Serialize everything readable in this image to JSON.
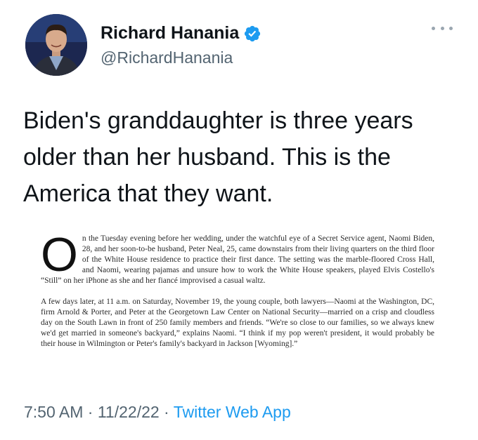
{
  "user": {
    "display_name": "Richard Hanania",
    "handle": "@RichardHanania",
    "verified_icon": "verified-badge-icon",
    "more_icon": "more-options-icon"
  },
  "tweet": {
    "text": "Biden's granddaughter is three years older than her husband. This is the America that they want."
  },
  "article": {
    "dropcap": "O",
    "paragraph1": "n the Tuesday evening before her wedding, under the watchful eye of a Secret Service agent, Naomi Biden, 28, and her soon-to-be husband, Peter Neal, 25, came downstairs from their living quarters on the third floor of the White House residence to practice their first dance. The setting was the marble-floored Cross Hall, and Naomi, wearing pajamas and unsure how to work the White House speakers, played Elvis Costello's “Still” on her iPhone as she and her fiancé improvised a casual waltz.",
    "paragraph2": "A few days later, at 11 a.m. on Saturday, November 19, the young couple, both lawyers—Naomi at the Washington, DC, firm Arnold & Porter, and Peter at the Georgetown Law Center on National Security—married on a crisp and cloudless day on the South Lawn in front of 250 family members and friends. “We're so close to our families, so we always knew we'd get married in someone's backyard,” explains Naomi. “I think if my pop weren't president, it would probably be their house in Wilmington or Peter's family's backyard in Jackson [Wyoming].”"
  },
  "meta": {
    "time": "7:50 AM",
    "sep1": " · ",
    "date": "11/22/22",
    "sep2": " · ",
    "app": "Twitter Web App"
  },
  "colors": {
    "accent": "#1d9bf0",
    "secondary_text": "#536471",
    "primary_text": "#0f1419"
  }
}
